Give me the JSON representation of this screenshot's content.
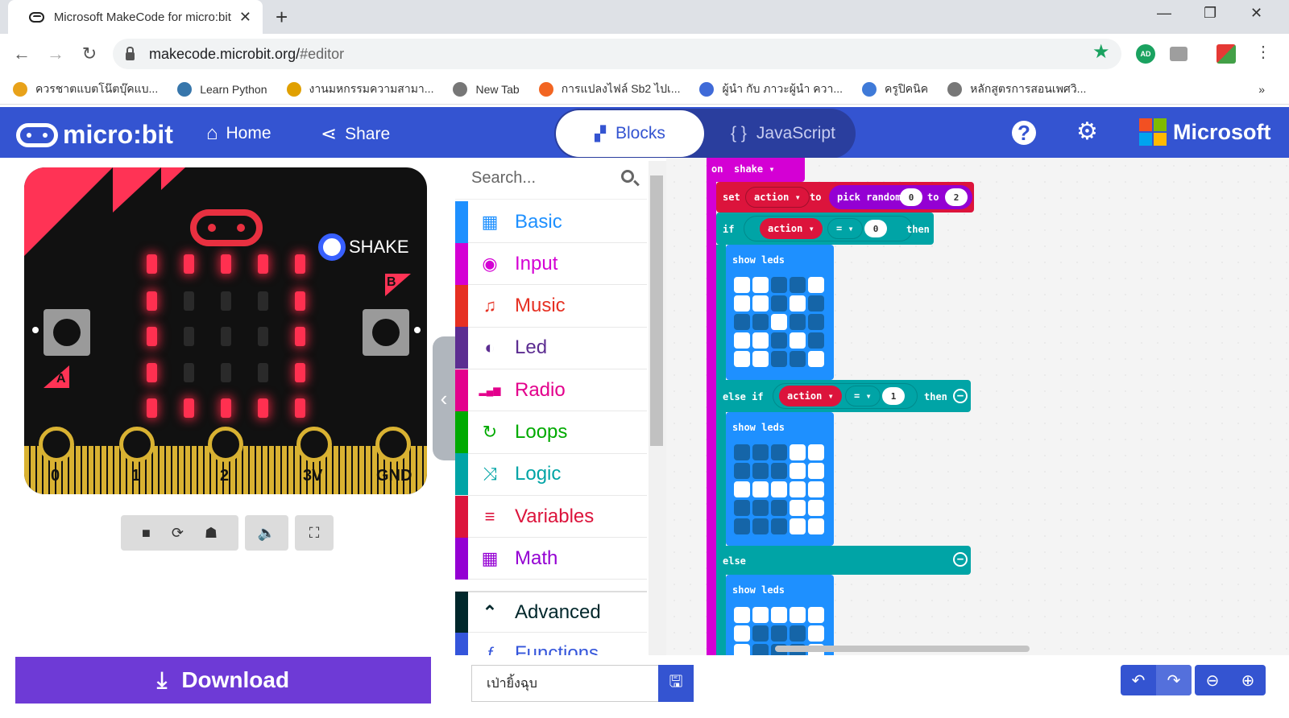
{
  "browser": {
    "tab_title": "Microsoft MakeCode for micro:bit",
    "url_host": "makecode.microbit.org/",
    "url_path": "#editor",
    "ext_badge": "AD",
    "bookmarks": [
      {
        "label": "ควรชาตแบตโน๊ตบุ๊คแบ...",
        "color": "#e8a21a"
      },
      {
        "label": "Learn Python",
        "color": "#3776ab"
      },
      {
        "label": "งานมหกรรมความสามา...",
        "color": "#e0a000"
      },
      {
        "label": "New Tab",
        "color": "#777777"
      },
      {
        "label": "การแปลงไฟล์ Sb2 ไปเ...",
        "color": "#f26522"
      },
      {
        "label": "ผู้นำ กับ ภาวะผู้นำ ควา...",
        "color": "#3f6ad8"
      },
      {
        "label": "ครูปิคนิค",
        "color": "#3f7ad8"
      },
      {
        "label": "หลักสูตรการสอนเพศวิ...",
        "color": "#777777"
      }
    ]
  },
  "header": {
    "brand": "micro:bit",
    "home": "Home",
    "share": "Share",
    "blocks": "Blocks",
    "javascript": "JavaScript",
    "help": "?",
    "microsoft": "Microsoft"
  },
  "simulator": {
    "shake_label": "SHAKE",
    "button_a": "A",
    "button_b": "B",
    "pins": [
      "0",
      "1",
      "2",
      "3V",
      "GND"
    ],
    "leds": [
      [
        1,
        1,
        1,
        1,
        1
      ],
      [
        1,
        0,
        0,
        0,
        1
      ],
      [
        1,
        0,
        0,
        0,
        1
      ],
      [
        1,
        0,
        0,
        0,
        1
      ],
      [
        1,
        1,
        1,
        1,
        1
      ]
    ],
    "download": "Download"
  },
  "toolbox": {
    "search_placeholder": "Search...",
    "categories": [
      {
        "label": "Basic",
        "color": "#1e90ff",
        "icon": "▦"
      },
      {
        "label": "Input",
        "color": "#d400d4",
        "icon": "◉"
      },
      {
        "label": "Music",
        "color": "#e63022",
        "icon": "♫"
      },
      {
        "label": "Led",
        "color": "#5c2d91",
        "icon": "◐"
      },
      {
        "label": "Radio",
        "color": "#e3008c",
        "icon": "▂▄▆"
      },
      {
        "label": "Loops",
        "color": "#00aa00",
        "icon": "↻"
      },
      {
        "label": "Logic",
        "color": "#00a4a6",
        "icon": "⤨"
      },
      {
        "label": "Variables",
        "color": "#dc143c",
        "icon": "≡"
      },
      {
        "label": "Math",
        "color": "#9400d3",
        "icon": "▦"
      }
    ],
    "advanced": {
      "label": "Advanced",
      "color": "#00272b",
      "icon": "⌃"
    },
    "functions": {
      "label": "Functions",
      "color": "#3455db",
      "icon": "ƒ"
    }
  },
  "workspace": {
    "on_label": "on",
    "event": "shake",
    "set_label": "set",
    "var": "action",
    "to_label": "to",
    "pick_random": "pick random",
    "rand_from": "0",
    "rand_to": "2",
    "if_label": "if",
    "eq": "=",
    "cmp0": "0",
    "then_label": "then",
    "elseif_label": "else if",
    "cmp1": "1",
    "else_label": "else",
    "show_leds": "show leds",
    "grid1": [
      [
        1,
        1,
        0,
        0,
        1
      ],
      [
        1,
        1,
        0,
        1,
        0
      ],
      [
        0,
        0,
        1,
        0,
        0
      ],
      [
        1,
        1,
        0,
        1,
        0
      ],
      [
        1,
        1,
        0,
        0,
        1
      ]
    ],
    "grid2": [
      [
        0,
        0,
        0,
        1,
        1
      ],
      [
        0,
        0,
        0,
        1,
        1
      ],
      [
        1,
        1,
        1,
        1,
        1
      ],
      [
        0,
        0,
        0,
        1,
        1
      ],
      [
        0,
        0,
        0,
        1,
        1
      ]
    ],
    "grid3": [
      [
        1,
        1,
        1,
        1,
        1
      ],
      [
        1,
        0,
        0,
        0,
        1
      ],
      [
        1,
        0,
        0,
        0,
        1
      ]
    ]
  },
  "bottom": {
    "project_name": "เป่ายิ้งฉุบ"
  }
}
